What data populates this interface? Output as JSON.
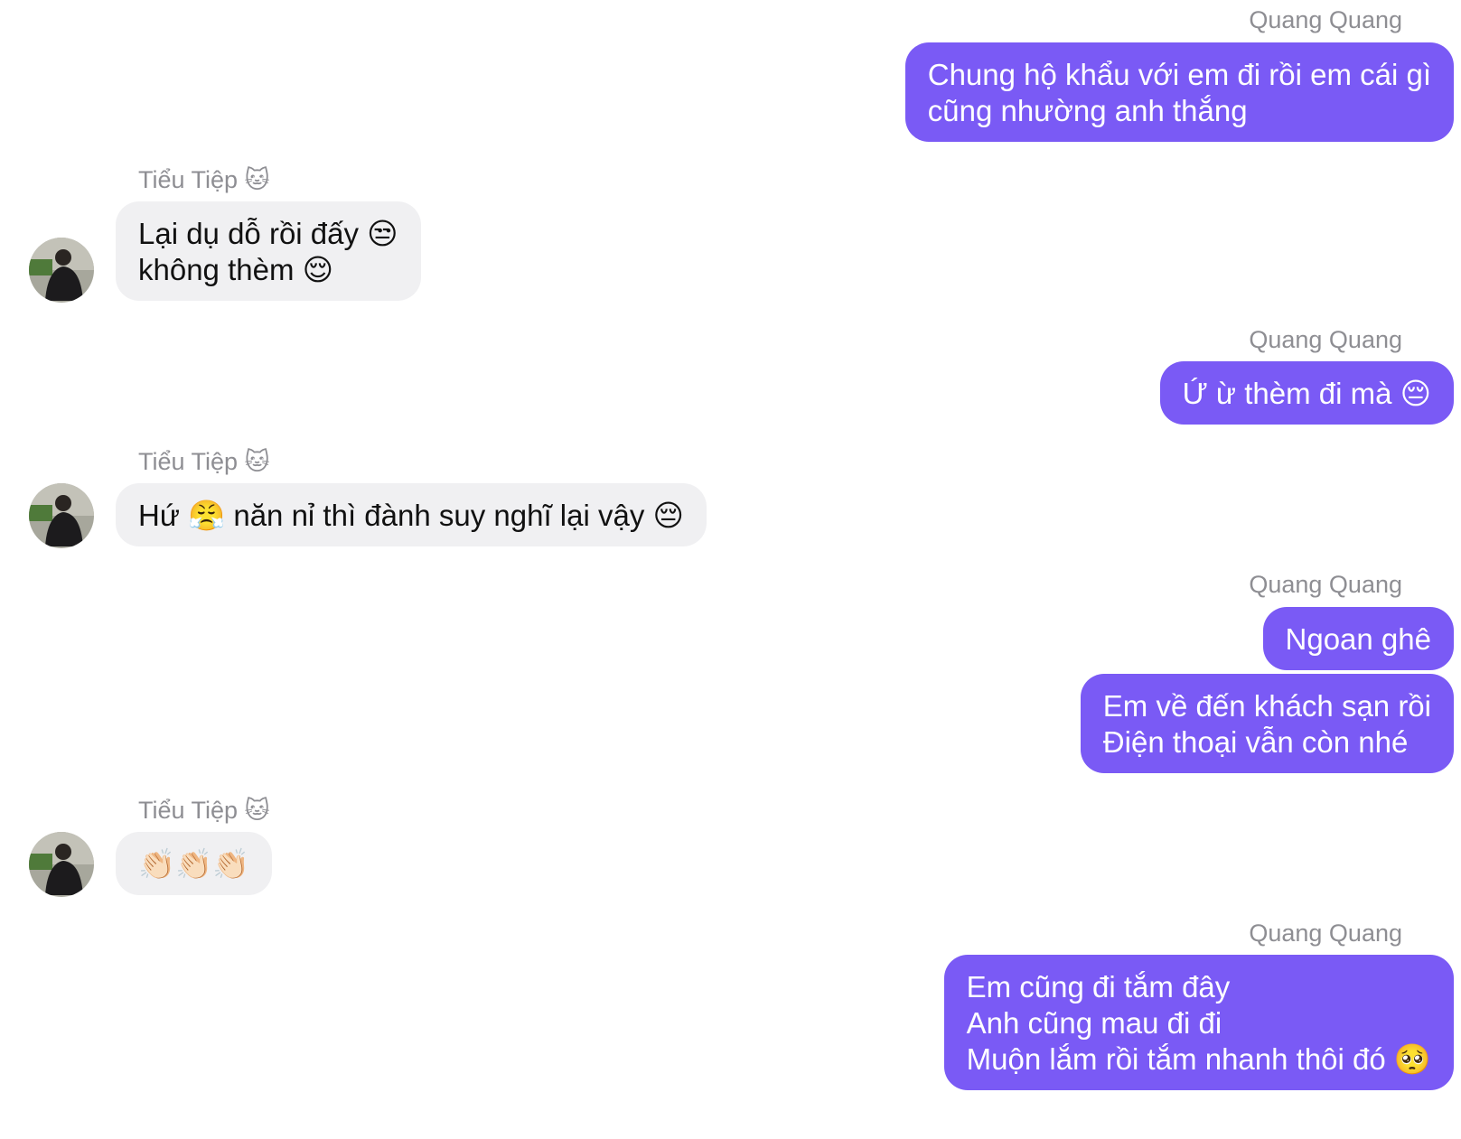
{
  "contacts": {
    "me": "Quang Quang",
    "them": "Tiểu Tiệp 🐱"
  },
  "messages": [
    {
      "sender": "Quang Quang",
      "lines": [
        "Chung hộ khẩu với em đi rồi em cái gì",
        "cũng nhường anh thắng"
      ]
    },
    {
      "sender": "Tiểu Tiệp 🐱",
      "lines": [
        "Lại dụ dỗ rồi đấy 😒",
        "không thèm 😌"
      ]
    },
    {
      "sender": "Quang Quang",
      "lines": [
        "Ứ ừ thèm đi mà 😔"
      ]
    },
    {
      "sender": "Tiểu Tiệp 🐱",
      "lines": [
        "Hứ 😤 năn nỉ thì đành suy nghĩ lại vậy 😔"
      ]
    },
    {
      "sender": "Quang Quang",
      "lines": [
        "Ngoan ghê"
      ]
    },
    {
      "sender": "Quang Quang",
      "lines": [
        "Em về đến khách sạn rồi",
        "Điện thoại vẫn còn nhé"
      ]
    },
    {
      "sender": "Tiểu Tiệp 🐱",
      "lines": [
        "👏🏻👏🏻👏🏻"
      ]
    },
    {
      "sender": "Quang Quang",
      "lines": [
        "Em cũng đi tắm đây",
        "Anh cũng mau đi đi",
        "Muộn lắm rồi tắm nhanh thôi đó 🥺"
      ]
    }
  ],
  "colors": {
    "outgoing_bubble": "#7a5af5",
    "incoming_bubble": "#f0f0f2",
    "sender_name": "#8e8e93"
  }
}
